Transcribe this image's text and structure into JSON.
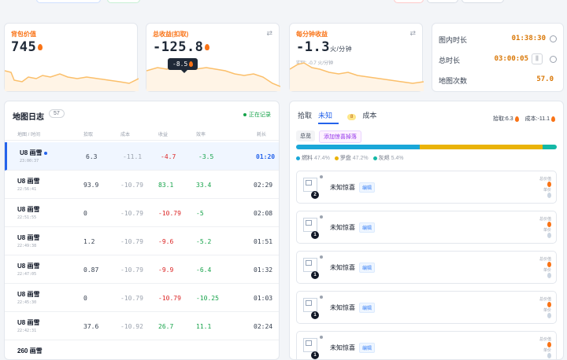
{
  "stats": {
    "backpack": {
      "label": "背包价值",
      "value": "745"
    },
    "total_income": {
      "label": "总收益(扣取)",
      "value": "-125.8",
      "tooltip": "-8.5"
    },
    "per_minute": {
      "label": "每分钟收益",
      "value": "-1.3",
      "unit": "火/分钟",
      "sub": "实际: -0.7 火/分钟"
    }
  },
  "timers": [
    {
      "label": "图内时长",
      "value": "01:38:30"
    },
    {
      "label": "总时长",
      "value": "03:00:05",
      "pause": "||"
    },
    {
      "label": "地图次数",
      "value": "57.0"
    }
  ],
  "log": {
    "title": "地图日志",
    "count": "57",
    "status": "正在记录",
    "headers": [
      "地图 / 时间",
      "拾取",
      "成本",
      "收益",
      "效率",
      "耗长"
    ],
    "rows": [
      {
        "map": "U8 画雪",
        "time": "23:00:37",
        "pick": "6.3",
        "cost": "-11.1",
        "income": "-4.7",
        "rate": "-3.5",
        "dur": "01:20"
      },
      {
        "map": "U8 画雪",
        "time": "22:56:41",
        "pick": "93.9",
        "cost": "-10.79",
        "income": "83.1",
        "rate": "33.4",
        "dur": "02:29"
      },
      {
        "map": "U8 画雪",
        "time": "22:51:55",
        "pick": "0",
        "cost": "-10.79",
        "income": "-10.79",
        "rate": "-5",
        "dur": "02:08"
      },
      {
        "map": "U8 画雪",
        "time": "22:49:38",
        "pick": "1.2",
        "cost": "-10.79",
        "income": "-9.6",
        "rate": "-5.2",
        "dur": "01:51"
      },
      {
        "map": "U8 画雪",
        "time": "22:47:05",
        "pick": "0.87",
        "cost": "-10.79",
        "income": "-9.9",
        "rate": "-6.4",
        "dur": "01:32"
      },
      {
        "map": "U8 画雪",
        "time": "22:45:30",
        "pick": "0",
        "cost": "-10.79",
        "income": "-10.79",
        "rate": "-10.25",
        "dur": "01:03"
      },
      {
        "map": "U8 画雪",
        "time": "22:42:31",
        "pick": "37.6",
        "cost": "-10.92",
        "income": "26.7",
        "rate": "11.1",
        "dur": "02:24"
      },
      {
        "map": "260 画雪",
        "time": "",
        "pick": "",
        "cost": "",
        "income": "",
        "rate": "",
        "dur": ""
      }
    ]
  },
  "right": {
    "tabs": [
      "拾取",
      "未知",
      "成本"
    ],
    "unknown_badge": "8",
    "summary": "拾取:6.3",
    "summary_cost": "成本:-11.1",
    "chips": [
      "总览",
      "添加惊喜掉落"
    ],
    "legend": [
      {
        "name": "燃料",
        "pct": "47.4%",
        "color": "#1aa7d8"
      },
      {
        "name": "罗盘",
        "pct": "47.2%",
        "color": "#eab308"
      },
      {
        "name": "灰烬",
        "pct": "5.4%",
        "color": "#14b8a6"
      }
    ],
    "items": [
      {
        "name": "未知惊喜",
        "edit": "编辑",
        "num": "2",
        "r1": "总价值",
        "r3": "单价"
      },
      {
        "name": "未知惊喜",
        "edit": "编辑",
        "num": "1",
        "r1": "总价值",
        "r3": "单价"
      },
      {
        "name": "未知惊喜",
        "edit": "编辑",
        "num": "1",
        "r1": "总价值",
        "r3": "单价"
      },
      {
        "name": "未知惊喜",
        "edit": "编辑",
        "num": "1",
        "r1": "总价值",
        "r3": "单价"
      },
      {
        "name": "未知惊喜",
        "edit": "编辑",
        "num": "1",
        "r1": "总价值",
        "r3": "单价"
      }
    ]
  },
  "colors": {
    "accent": "#2563eb",
    "fire": "#f97316",
    "positive": "#16a34a",
    "negative": "#dc2626"
  }
}
